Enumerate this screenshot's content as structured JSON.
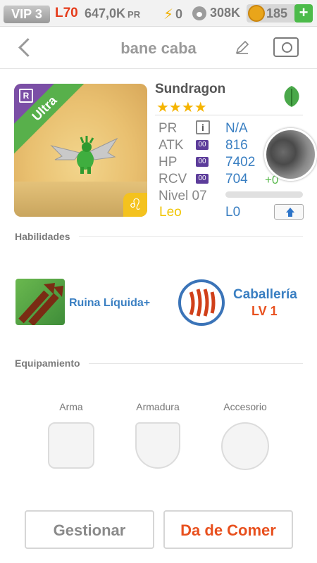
{
  "status_bar": {
    "vip": "VIP 3",
    "level": "L70",
    "coins": "647,0K",
    "coins_unit": "PR",
    "energy": "0",
    "paw": "308K",
    "gems": "185",
    "add_label": "+"
  },
  "header": {
    "title": "bane caba"
  },
  "monster": {
    "name": "Sundragon",
    "stars": "★★★★",
    "rarity": "Ultra",
    "rarity_badge": "R",
    "zodiac_symbol": "♌",
    "stats": [
      {
        "label": "PR",
        "value": "N/A"
      },
      {
        "label": "ATK",
        "value": "816",
        "badge": "00"
      },
      {
        "label": "HP",
        "value": "7402",
        "badge": "00"
      },
      {
        "label": "RCV",
        "value": "704",
        "badge": "00",
        "bonus": "+0"
      }
    ],
    "bonus_plus": "+",
    "info_label": "i",
    "level_label": "Nivel 07",
    "level_progress": 0,
    "sign": "Leo",
    "l_value": "L0"
  },
  "skills": {
    "section_title": "Habilidades",
    "skill1_name": "Ruina Líquida+",
    "skill2_name": "Caballería",
    "skill2_level": "LV 1"
  },
  "equipment": {
    "section_title": "Equipamiento",
    "weapon": "Arma",
    "armor": "Armadura",
    "accessory": "Accesorio"
  },
  "actions": {
    "manage": "Gestionar",
    "feed": "Da de Comer"
  },
  "colors": {
    "accent_blue": "#3a7fc2",
    "orange": "#e8501e",
    "green": "#58b04b",
    "gold": "#f5b400"
  }
}
